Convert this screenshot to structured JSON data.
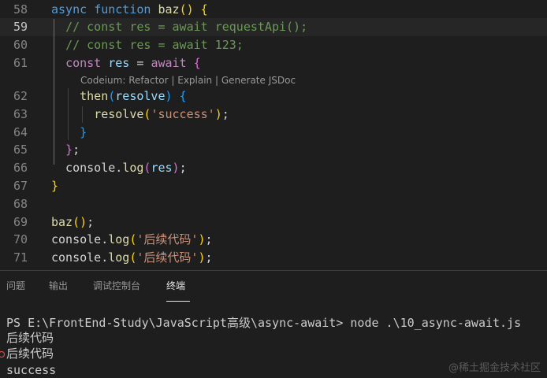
{
  "editor": {
    "lines": [
      {
        "num": "58",
        "tokens": [
          {
            "t": "async",
            "c": "kw2"
          },
          {
            "t": " "
          },
          {
            "t": "function",
            "c": "kw2"
          },
          {
            "t": " "
          },
          {
            "t": "baz",
            "c": "fn"
          },
          {
            "t": "()",
            "c": "brace-y"
          },
          {
            "t": " "
          },
          {
            "t": "{",
            "c": "brace-y"
          }
        ]
      },
      {
        "num": "59",
        "tokens": [
          {
            "t": "  "
          },
          {
            "t": "// const res = await requestApi();",
            "c": "cm"
          }
        ],
        "active": true
      },
      {
        "num": "60",
        "tokens": [
          {
            "t": "  "
          },
          {
            "t": "// const res = await 123;",
            "c": "cm"
          }
        ]
      },
      {
        "num": "61",
        "tokens": [
          {
            "t": "  "
          },
          {
            "t": "const",
            "c": "kw"
          },
          {
            "t": " "
          },
          {
            "t": "res",
            "c": "var"
          },
          {
            "t": " = "
          },
          {
            "t": "await",
            "c": "kw"
          },
          {
            "t": " "
          },
          {
            "t": "{",
            "c": "brace-p"
          }
        ]
      },
      {
        "num": "62",
        "tokens": [
          {
            "t": "    "
          },
          {
            "t": "then",
            "c": "fn"
          },
          {
            "t": "(",
            "c": "brace-b"
          },
          {
            "t": "resolve",
            "c": "var"
          },
          {
            "t": ")",
            "c": "brace-b"
          },
          {
            "t": " "
          },
          {
            "t": "{",
            "c": "brace-b"
          }
        ]
      },
      {
        "num": "63",
        "tokens": [
          {
            "t": "      "
          },
          {
            "t": "resolve",
            "c": "fn"
          },
          {
            "t": "(",
            "c": "brace-y"
          },
          {
            "t": "'success'",
            "c": "str"
          },
          {
            "t": ")",
            "c": "brace-y"
          },
          {
            "t": ";"
          }
        ]
      },
      {
        "num": "64",
        "tokens": [
          {
            "t": "    "
          },
          {
            "t": "}",
            "c": "brace-b"
          }
        ]
      },
      {
        "num": "65",
        "tokens": [
          {
            "t": "  "
          },
          {
            "t": "}",
            "c": "brace-p"
          },
          {
            "t": ";"
          }
        ]
      },
      {
        "num": "66",
        "tokens": [
          {
            "t": "  console"
          },
          {
            "t": "."
          },
          {
            "t": "log",
            "c": "fn"
          },
          {
            "t": "(",
            "c": "brace-p"
          },
          {
            "t": "res",
            "c": "var"
          },
          {
            "t": ")",
            "c": "brace-p"
          },
          {
            "t": ";"
          }
        ]
      },
      {
        "num": "67",
        "tokens": [
          {
            "t": "}",
            "c": "brace-y"
          }
        ]
      },
      {
        "num": "68",
        "tokens": []
      },
      {
        "num": "69",
        "tokens": [
          {
            "t": "baz",
            "c": "fn"
          },
          {
            "t": "()",
            "c": "brace-y"
          },
          {
            "t": ";"
          }
        ]
      },
      {
        "num": "70",
        "tokens": [
          {
            "t": "console"
          },
          {
            "t": "."
          },
          {
            "t": "log",
            "c": "fn"
          },
          {
            "t": "(",
            "c": "brace-y"
          },
          {
            "t": "'后续代码'",
            "c": "str"
          },
          {
            "t": ")",
            "c": "brace-y"
          },
          {
            "t": ";"
          }
        ]
      },
      {
        "num": "71",
        "tokens": [
          {
            "t": "console"
          },
          {
            "t": "."
          },
          {
            "t": "log",
            "c": "fn"
          },
          {
            "t": "(",
            "c": "brace-y"
          },
          {
            "t": "'后续代码'",
            "c": "str"
          },
          {
            "t": ")",
            "c": "brace-y"
          },
          {
            "t": ";"
          }
        ]
      }
    ],
    "codelens": {
      "prefix": "Codeium: ",
      "refactor": "Refactor",
      "sep1": " | ",
      "explain": "Explain",
      "sep2": " | ",
      "jsdoc": "Generate JSDoc"
    }
  },
  "panel": {
    "tabs": [
      {
        "label": "问题"
      },
      {
        "label": "输出"
      },
      {
        "label": "调试控制台"
      },
      {
        "label": "终端",
        "active": true
      }
    ]
  },
  "terminal": {
    "lines": [
      "PS E:\\FrontEnd-Study\\JavaScript高级\\async-await> node .\\10_async-await.js",
      "后续代码",
      "后续代码",
      "success"
    ]
  },
  "watermark": "@稀土掘金技术社区",
  "colors": {
    "background": "#1e1e1e",
    "keyword_blue": "#569cd6",
    "keyword_purple": "#c586c0",
    "function": "#dcdcaa",
    "variable": "#9cdcfe",
    "comment": "#6a9955",
    "string": "#ce9178"
  }
}
